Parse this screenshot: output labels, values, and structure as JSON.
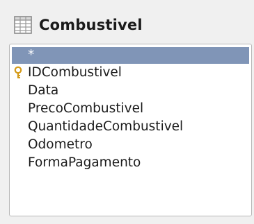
{
  "table": {
    "title": "Combustivel",
    "icon": "table-icon",
    "fields": [
      {
        "label": "*",
        "selected": true,
        "primary_key": false
      },
      {
        "label": "IDCombustivel",
        "selected": false,
        "primary_key": true
      },
      {
        "label": "Data",
        "selected": false,
        "primary_key": false
      },
      {
        "label": "PrecoCombustivel",
        "selected": false,
        "primary_key": false
      },
      {
        "label": "QuantidadeCombustivel",
        "selected": false,
        "primary_key": false
      },
      {
        "label": "Odometro",
        "selected": false,
        "primary_key": false
      },
      {
        "label": "FormaPagamento",
        "selected": false,
        "primary_key": false
      }
    ]
  },
  "colors": {
    "selection": "#8095b7",
    "key": "#e0a020"
  }
}
